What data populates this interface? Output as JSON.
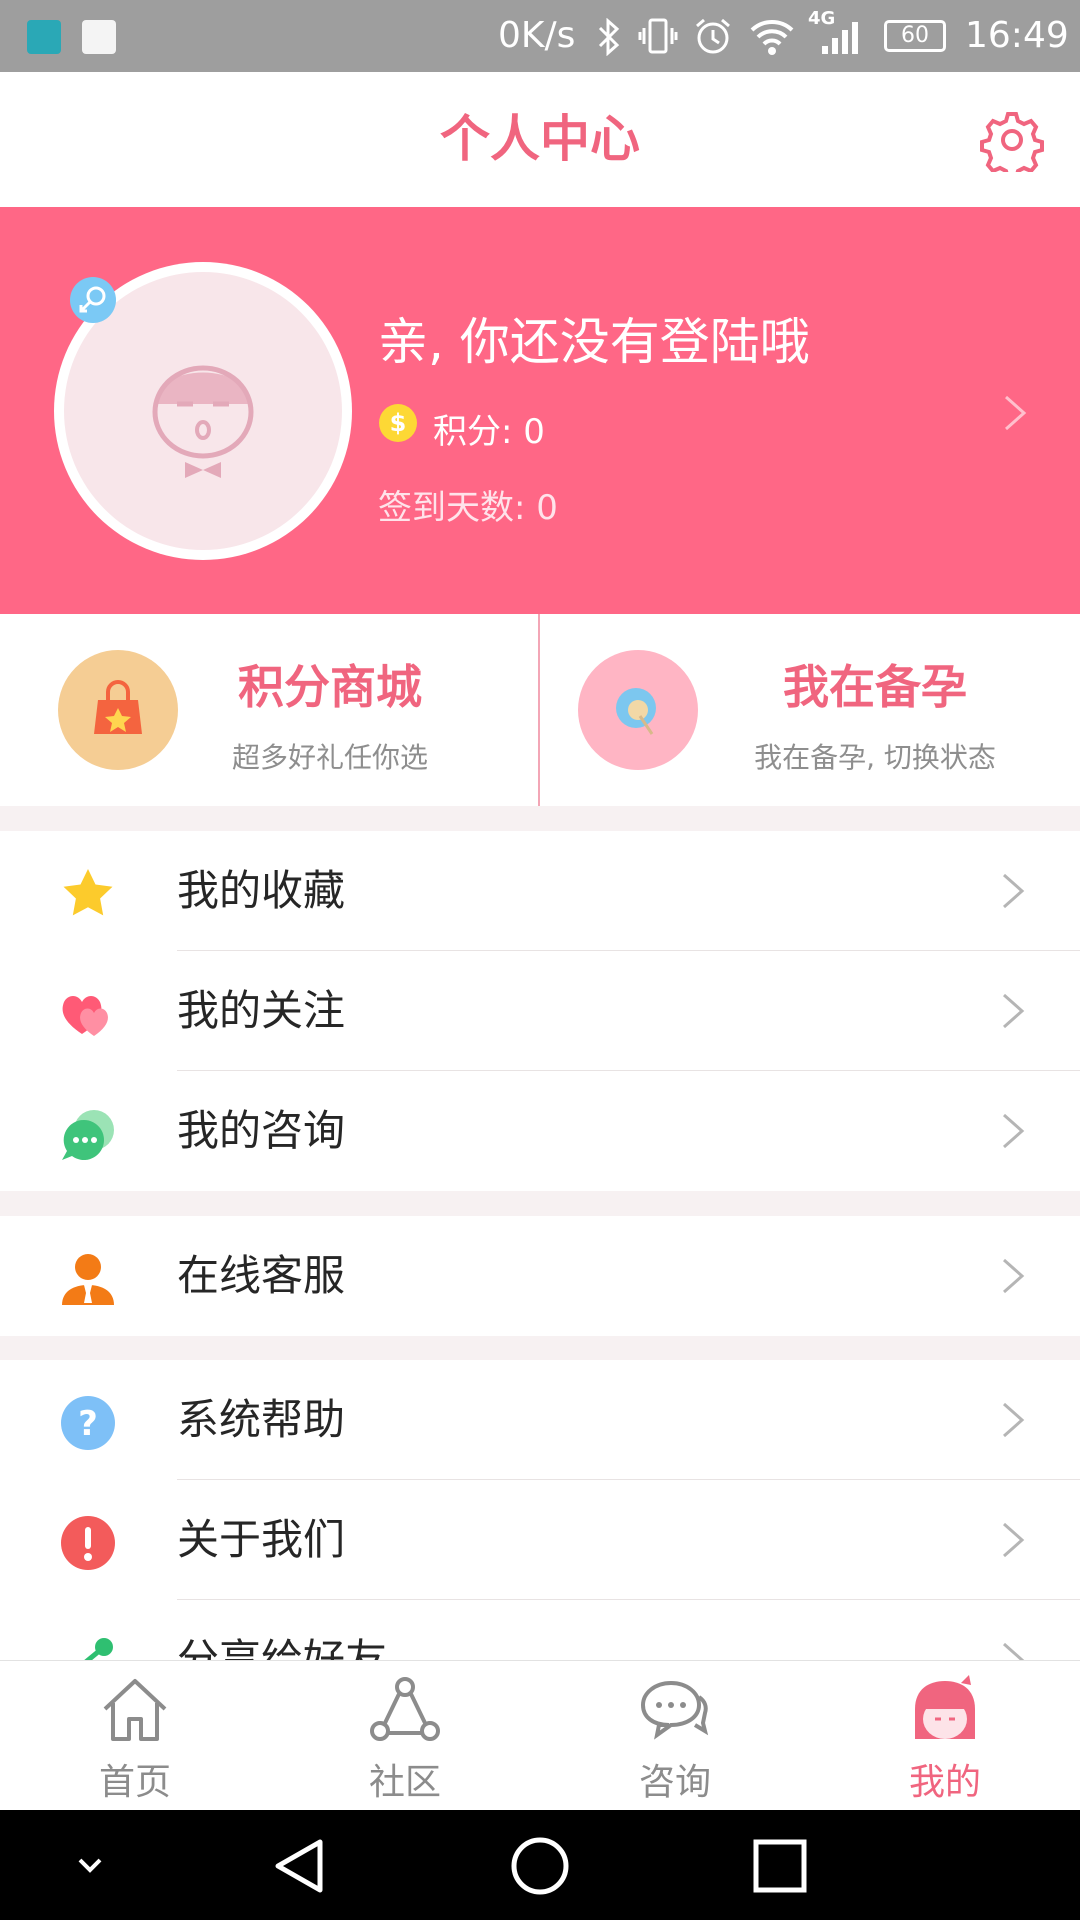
{
  "status_bar": {
    "speed": "0K/s",
    "signal": "4G",
    "battery": "60",
    "time": "16:49"
  },
  "header": {
    "title": "个人中心",
    "settings_icon": "gear-icon"
  },
  "profile": {
    "login_prompt": "亲, 你还没有登陆哦",
    "points": "积分: 0",
    "sign_days": "签到天数: 0"
  },
  "quick_cards": [
    {
      "title": "积分商城",
      "subtitle": "超多好礼任你选",
      "icon": "shopping-bag-icon"
    },
    {
      "title": "我在备孕",
      "subtitle": "我在备孕, 切换状态",
      "icon": "flower-icon"
    }
  ],
  "menu_groups": [
    [
      {
        "label": "我的收藏",
        "icon": "star-icon"
      },
      {
        "label": "我的关注",
        "icon": "heart-icon"
      },
      {
        "label": "我的咨询",
        "icon": "chat-bubble-icon"
      }
    ],
    [
      {
        "label": "在线客服",
        "icon": "agent-icon"
      }
    ],
    [
      {
        "label": "系统帮助",
        "icon": "help-icon"
      },
      {
        "label": "关于我们",
        "icon": "info-icon"
      },
      {
        "label": "分享给好友",
        "icon": "share-icon"
      }
    ]
  ],
  "bottom_nav": [
    {
      "label": "首页",
      "icon": "home-icon",
      "active": false
    },
    {
      "label": "社区",
      "icon": "community-icon",
      "active": false
    },
    {
      "label": "咨询",
      "icon": "consult-icon",
      "active": false
    },
    {
      "label": "我的",
      "icon": "profile-girl-icon",
      "active": true
    }
  ],
  "colors": {
    "accent": "#f0657f",
    "banner": "#ff6786",
    "status_bar": "#9e9e9e"
  }
}
